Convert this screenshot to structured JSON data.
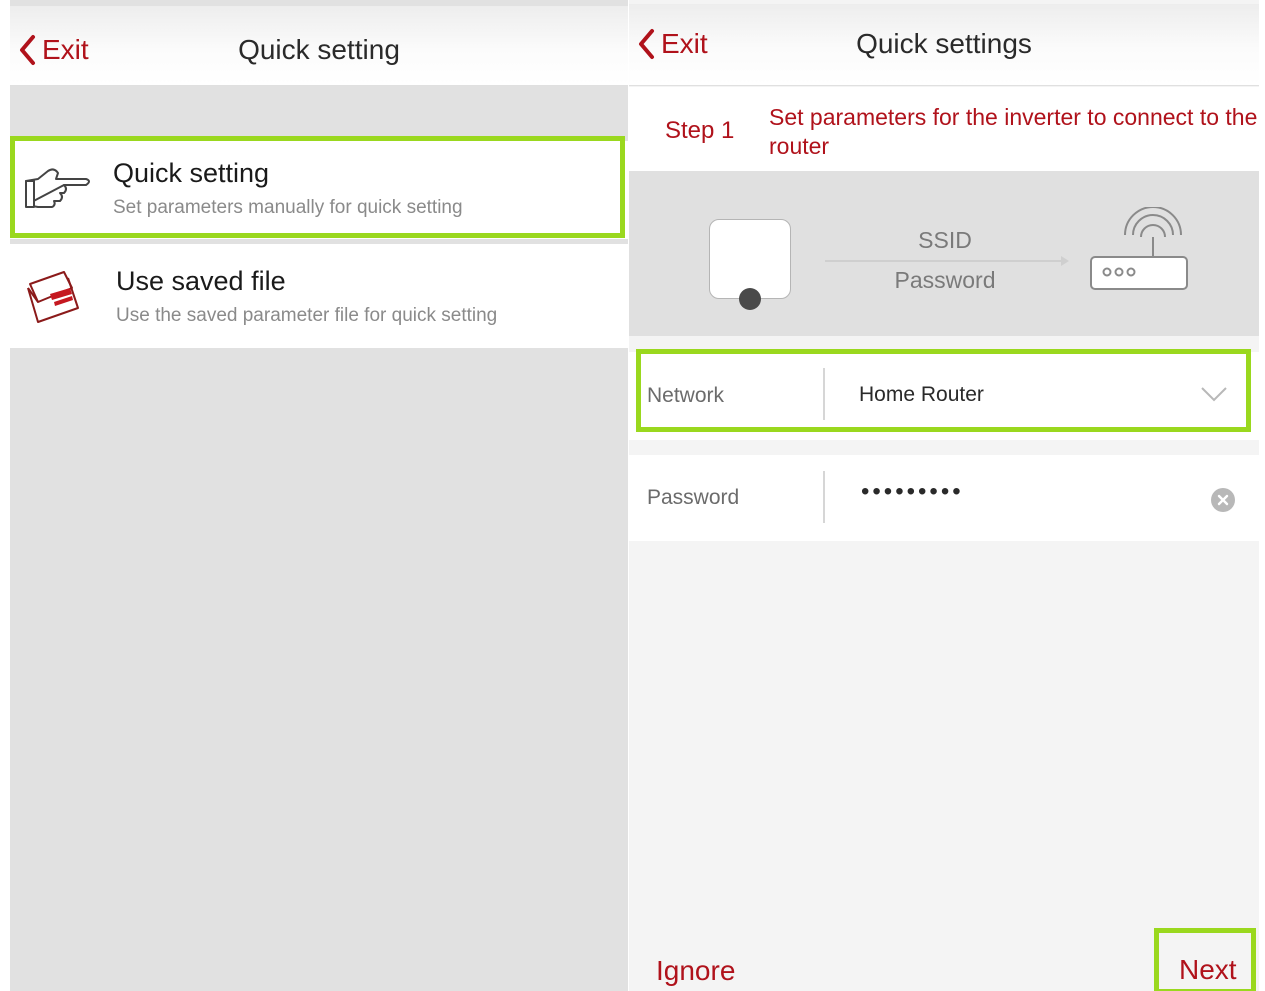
{
  "left_screen": {
    "header": {
      "back_label": "Exit",
      "title": "Quick setting"
    },
    "options": [
      {
        "title": "Quick setting",
        "subtitle": "Set parameters manually for quick setting",
        "icon": "pointing-hand-icon",
        "highlighted": true
      },
      {
        "title": "Use saved file",
        "subtitle": "Use the saved parameter file for quick setting",
        "icon": "saved-file-folder-icon",
        "highlighted": false
      }
    ]
  },
  "right_screen": {
    "header": {
      "back_label": "Exit",
      "title": "Quick settings"
    },
    "step": {
      "number": "Step 1",
      "description": "Set parameters for the inverter to connect to the router"
    },
    "diagram": {
      "ssid_label": "SSID",
      "password_label": "Password",
      "device_icon": "inverter-device-icon",
      "router_icon": "wifi-router-icon"
    },
    "fields": {
      "network": {
        "label": "Network",
        "value": "Home Router",
        "icon": "chevron-down-icon",
        "highlighted": true
      },
      "password": {
        "label": "Password",
        "value": "•••••••••",
        "icon": "clear-icon"
      }
    },
    "footer": {
      "ignore_label": "Ignore",
      "next_label": "Next"
    }
  },
  "colors": {
    "accent": "#b0121b",
    "highlight": "#9ad81e",
    "panel_bg": "#e1e1e1"
  }
}
